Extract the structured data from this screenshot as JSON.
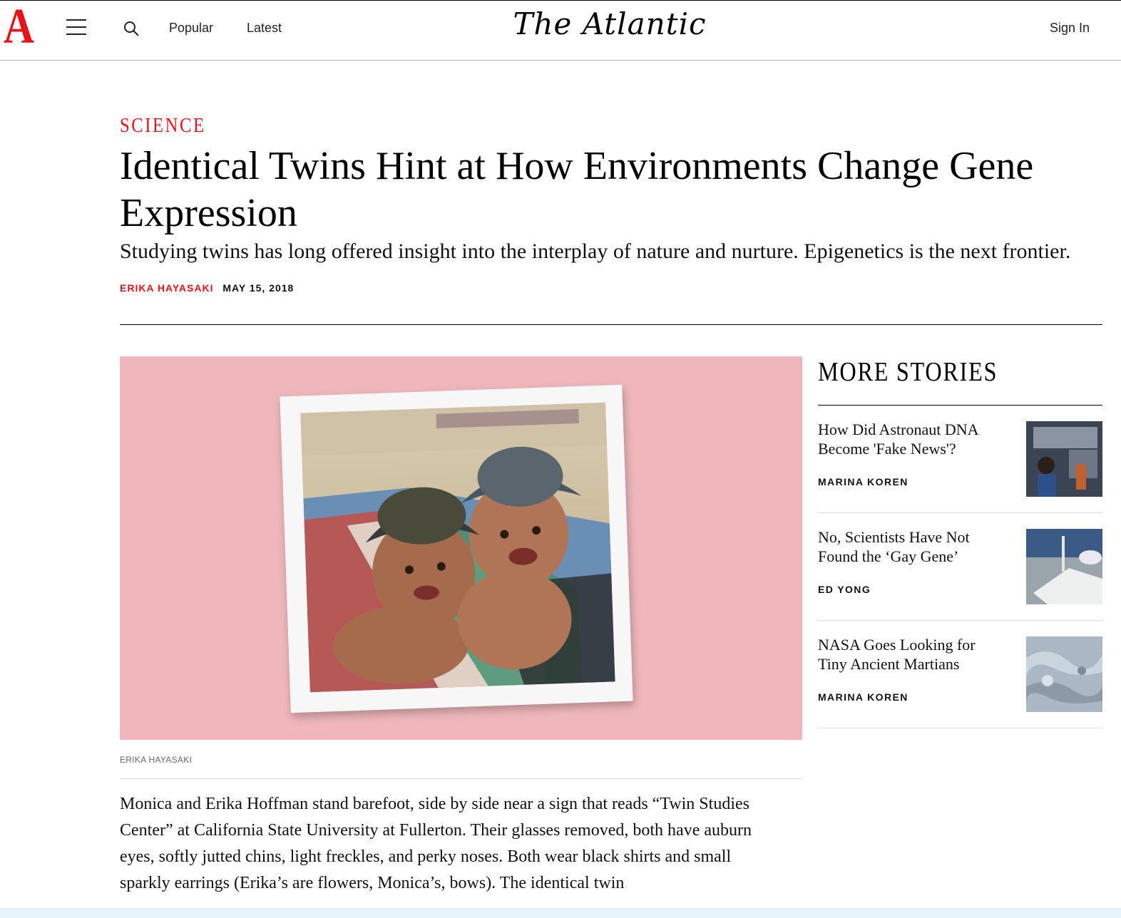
{
  "header": {
    "logo_letter": "A",
    "nav": [
      "Popular",
      "Latest"
    ],
    "masthead": "The Atlantic",
    "sign_in": "Sign In"
  },
  "article": {
    "section": "SCIENCE",
    "headline": "Identical Twins Hint at How Environments Change Gene Expression",
    "dek": "Studying twins has long offered insight into the interplay of nature and nurture. Epigenetics is the next frontier.",
    "author": "ERIKA HAYASAKI",
    "date": "MAY 15, 2018",
    "image_credit": "ERIKA HAYASAKI",
    "body": "Monica and Erika Hoffman stand barefoot, side by side near a sign that reads “Twin Studies Center” at California State University at Fullerton. Their glasses removed, both have auburn eyes, softly jutted chins, light freckles, and perky noses. Both wear black shirts and small sparkly earrings (Erika’s are flowers, Monica’s, bows). The identical twin"
  },
  "sidebar": {
    "title": "MORE STORIES",
    "stories": [
      {
        "title": "How Did Astronaut DNA Become 'Fake News'?",
        "author": "MARINA KOREN"
      },
      {
        "title": "No, Scientists Have Not Found the ‘Gay Gene’",
        "author": "ED YONG"
      },
      {
        "title": "NASA Goes Looking for Tiny Ancient Martians",
        "author": "MARINA KOREN"
      }
    ]
  },
  "colors": {
    "accent": "#e7131a",
    "hero_bg": "#efb7bb"
  }
}
